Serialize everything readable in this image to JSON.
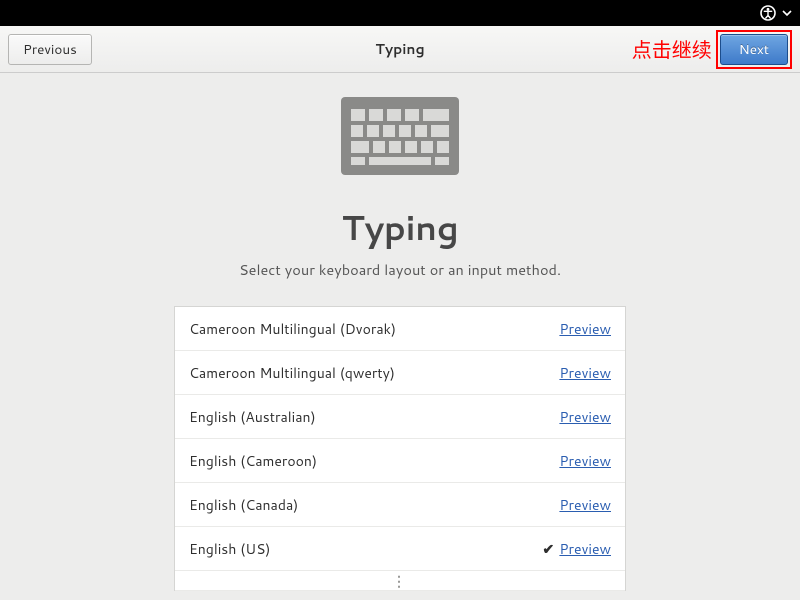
{
  "topbar": {
    "icons": [
      "accessibility-icon",
      "dropdown-icon"
    ]
  },
  "header": {
    "previous_label": "Previous",
    "title": "Typing",
    "next_label": "Next",
    "annotation": "点击继续"
  },
  "main": {
    "heading": "Typing",
    "subtitle": "Select your keyboard layout or an input method."
  },
  "layouts": [
    {
      "label": "Cameroon Multilingual (Dvorak)",
      "selected": false,
      "preview_label": "Preview"
    },
    {
      "label": "Cameroon Multilingual (qwerty)",
      "selected": false,
      "preview_label": "Preview"
    },
    {
      "label": "English (Australian)",
      "selected": false,
      "preview_label": "Preview"
    },
    {
      "label": "English (Cameroon)",
      "selected": false,
      "preview_label": "Preview"
    },
    {
      "label": "English (Canada)",
      "selected": false,
      "preview_label": "Preview"
    },
    {
      "label": "English (US)",
      "selected": true,
      "preview_label": "Preview"
    }
  ],
  "more_glyph": "⋮",
  "check_glyph": "✔"
}
